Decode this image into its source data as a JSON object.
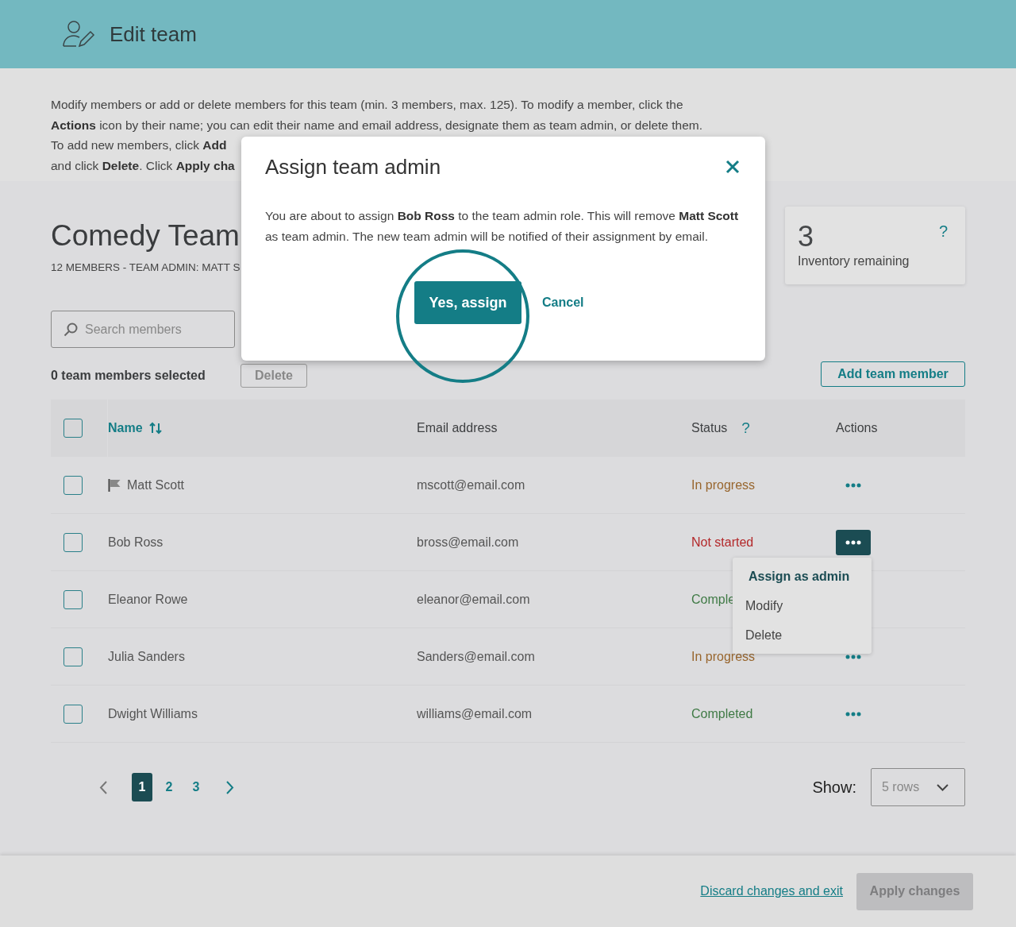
{
  "header": {
    "title": "Edit team"
  },
  "intro": {
    "lines": [
      "Modify members or add or delete members for this team (min. 3 members, max. 125). To modify a member, click the",
      "**Actions** icon by their name; you can edit their name and email address, designate them as team admin, or delete them.",
      "To add new members, click **Add**",
      "and click **Delete**. Click **Apply cha**"
    ]
  },
  "team": {
    "name": "Comedy Team",
    "subtitle": "12 MEMBERS - TEAM ADMIN: MATT S",
    "search": {
      "placeholder": "Search members"
    },
    "selected_count": "0 team members selected",
    "delete_button": "Delete"
  },
  "inventory": {
    "count": "3",
    "label": "Inventory remaining",
    "help": "?"
  },
  "add_button": "Add team member",
  "table": {
    "all_selected": false,
    "columns": [
      {
        "label": "Name",
        "sortable": true
      },
      {
        "label": "Email address",
        "sortable": false
      },
      {
        "label": "Status",
        "sortable": false,
        "help": "?"
      },
      {
        "label": "Actions",
        "sortable": false
      }
    ],
    "rows": [
      {
        "selected": false,
        "name": "Matt Scott",
        "admin": true,
        "email": "mscott@email.com",
        "status": {
          "label": "In progress",
          "color": "#98662e"
        },
        "menu_open": false
      },
      {
        "selected": false,
        "name": "Bob Ross",
        "admin": false,
        "email": "bross@email.com",
        "status": {
          "label": "Not started",
          "color": "#b3282a"
        },
        "menu_open": true
      },
      {
        "selected": false,
        "name": "Eleanor Rowe",
        "admin": false,
        "email": "eleanor@email.com",
        "status": {
          "label": "Comple",
          "color": "#3f7a45"
        },
        "menu_open": false
      },
      {
        "selected": false,
        "name": "Julia Sanders",
        "admin": false,
        "email": "Sanders@email.com",
        "status": {
          "label": "In progress",
          "color": "#98662e"
        },
        "menu_open": false
      },
      {
        "selected": false,
        "name": "Dwight Williams",
        "admin": false,
        "email": "williams@email.com",
        "status": {
          "label": "Completed",
          "color": "#3f7a45"
        },
        "menu_open": false
      }
    ],
    "menu": [
      {
        "label": "Assign as admin",
        "selected": true
      },
      {
        "label": "Modify",
        "selected": false
      },
      {
        "label": "Delete",
        "selected": false
      }
    ]
  },
  "pagination": {
    "pages": [
      {
        "label": "1",
        "selected": true
      },
      {
        "label": "2",
        "selected": false
      },
      {
        "label": "3",
        "selected": false
      }
    ],
    "show_label": "Show:",
    "rows_value": "5 rows"
  },
  "footer": {
    "discard": "Discard changes and exit",
    "apply": {
      "label": "Apply changes",
      "disabled": true
    }
  },
  "modal": {
    "title": "Assign team admin",
    "body": "You are about to assign **Bob Ross** to the team admin role. This will remove **Matt Scott** as team admin. The new team admin will be notified of their assignment by email.",
    "confirm": "Yes, assign",
    "cancel": "Cancel"
  }
}
